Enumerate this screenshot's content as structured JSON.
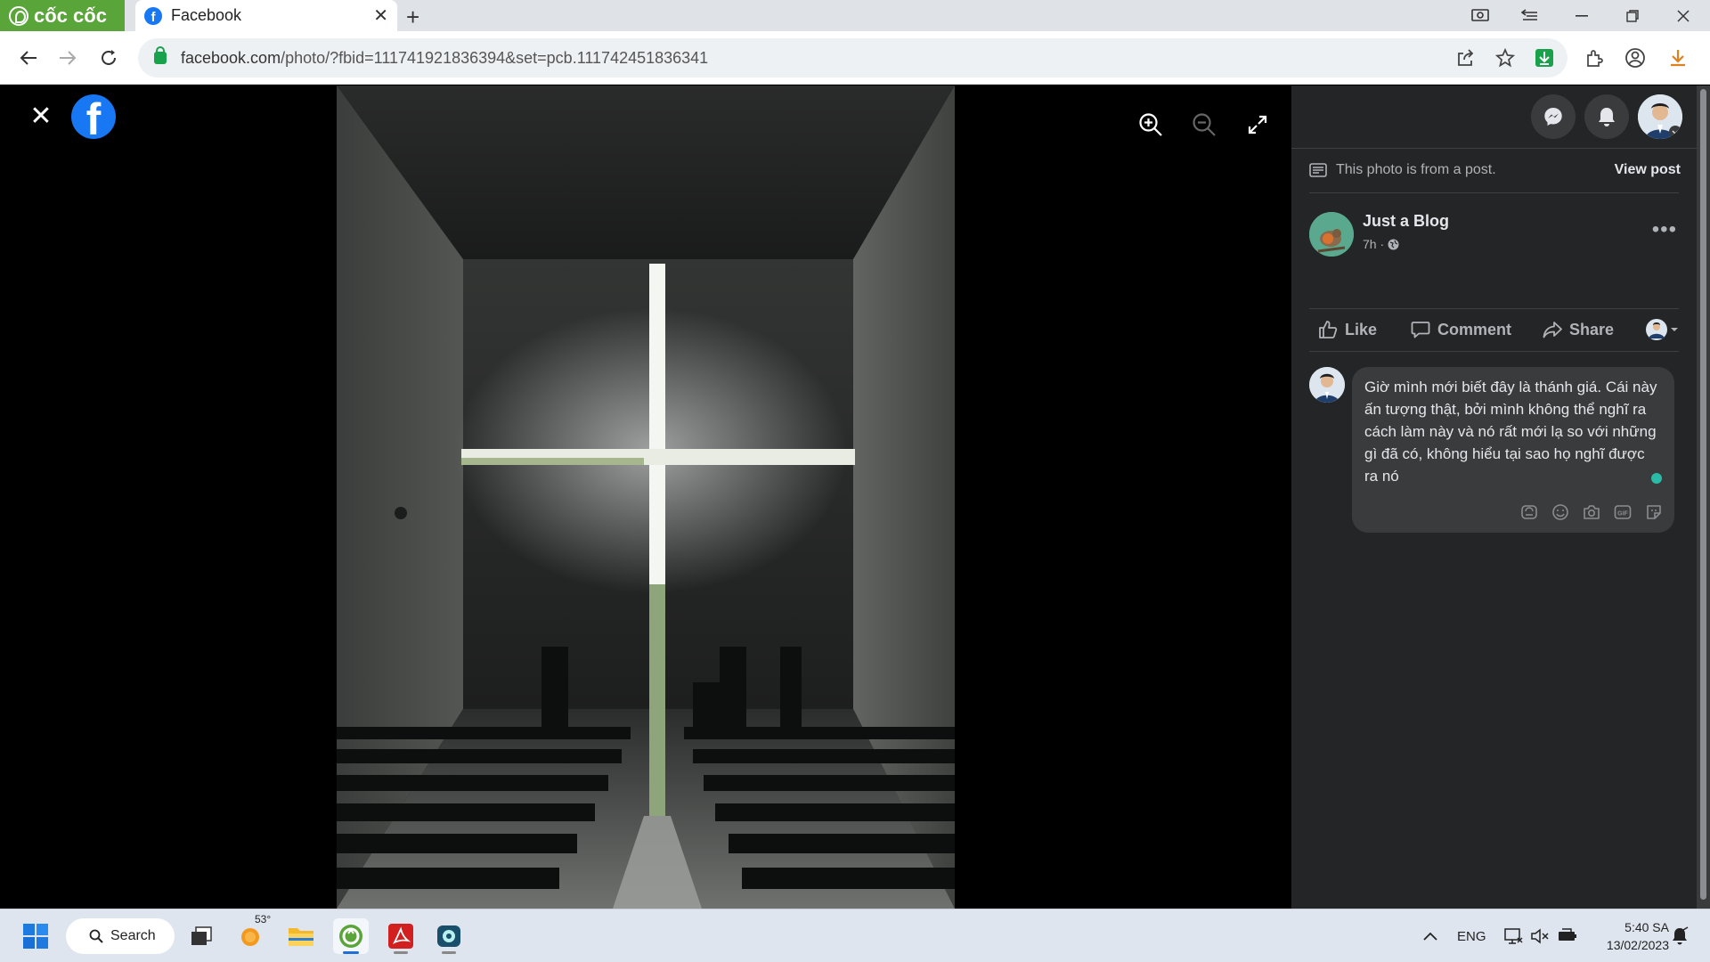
{
  "browser": {
    "brand": "cốc cốc",
    "tab_title": "Facebook",
    "url_domain": "facebook.com",
    "url_path": "/photo/?fbid=111741921836394&set=pcb.111742451836341"
  },
  "panel": {
    "post_note": "This photo is from a post.",
    "view_post": "View post",
    "page_name": "Just a Blog",
    "post_time": "7h ·",
    "actions": {
      "like": "Like",
      "comment": "Comment",
      "share": "Share"
    },
    "comment_draft": "Giờ mình mới biết đây là thánh giá. Cái này ấn tượng thật, bởi mình không thể nghĩ ra cách làm này và nó rất mới lạ so với những gì đã có, không hiểu tại sao họ nghĩ được ra nó"
  },
  "taskbar": {
    "search_label": "Search",
    "weather_temp": "53°",
    "language": "ENG",
    "time": "5:40 SA",
    "date": "13/02/2023"
  },
  "colors": {
    "fb_blue": "#1877f2",
    "panel_bg": "#242526",
    "coccoc_green": "#5aa53a"
  }
}
